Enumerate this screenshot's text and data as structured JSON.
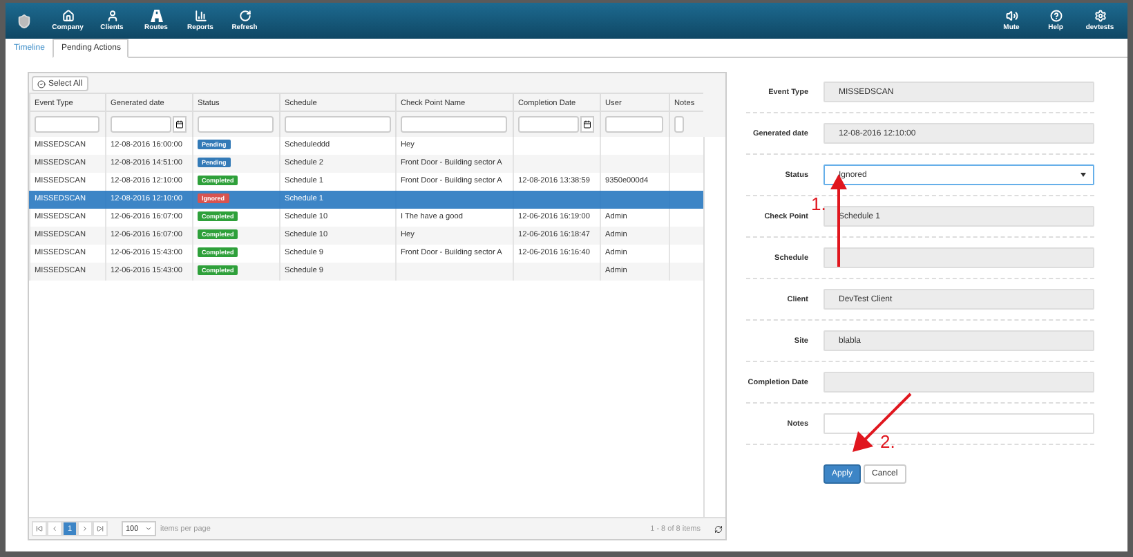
{
  "navbar": {
    "left": [
      {
        "label": "Company"
      },
      {
        "label": "Clients"
      },
      {
        "label": "Routes"
      },
      {
        "label": "Reports"
      },
      {
        "label": "Refresh"
      }
    ],
    "right": [
      {
        "label": "Mute"
      },
      {
        "label": "Help"
      },
      {
        "label": "devtests"
      }
    ]
  },
  "tabs": [
    {
      "label": "Timeline",
      "selected": false
    },
    {
      "label": "Pending Actions",
      "selected": true
    }
  ],
  "grid": {
    "select_all": "Select All",
    "columns": [
      {
        "label": "Event Type",
        "kind": "text"
      },
      {
        "label": "Generated date",
        "kind": "date"
      },
      {
        "label": "Status",
        "kind": "text"
      },
      {
        "label": "Schedule",
        "kind": "text"
      },
      {
        "label": "Check Point Name",
        "kind": "text"
      },
      {
        "label": "Completion Date",
        "kind": "date"
      },
      {
        "label": "User",
        "kind": "text"
      },
      {
        "label": "Notes",
        "kind": "text"
      }
    ],
    "rows": [
      {
        "selected": false,
        "event_type": "MISSEDSCAN",
        "generated": "12-08-2016 16:00:00",
        "status": {
          "text": "Pending",
          "kind": "pending"
        },
        "schedule": "Scheduleddd",
        "check_point": "Hey"
      },
      {
        "selected": false,
        "event_type": "MISSEDSCAN",
        "generated": "12-08-2016 14:51:00",
        "status": {
          "text": "Pending",
          "kind": "pending"
        },
        "schedule": "Schedule 2",
        "check_point": "Front Door - Building sector A"
      },
      {
        "selected": false,
        "event_type": "MISSEDSCAN",
        "generated": "12-08-2016 12:10:00",
        "status": {
          "text": "Completed",
          "kind": "completed"
        },
        "schedule": "Schedule 1",
        "check_point": "Front Door - Building sector A",
        "completion": "12-08-2016 13:38:59",
        "user": "9350e000d4"
      },
      {
        "selected": true,
        "event_type": "MISSEDSCAN",
        "generated": "12-08-2016 12:10:00",
        "status": {
          "text": "Ignored",
          "kind": "ignored"
        },
        "schedule": "Schedule 1"
      },
      {
        "selected": false,
        "event_type": "MISSEDSCAN",
        "generated": "12-06-2016 16:07:00",
        "status": {
          "text": "Completed",
          "kind": "completed"
        },
        "schedule": "Schedule 10",
        "check_point": "I The have a good",
        "completion": "12-06-2016 16:19:00",
        "user": "Admin"
      },
      {
        "selected": false,
        "event_type": "MISSEDSCAN",
        "generated": "12-06-2016 16:07:00",
        "status": {
          "text": "Completed",
          "kind": "completed"
        },
        "schedule": "Schedule 10",
        "check_point": "Hey",
        "completion": "12-06-2016 16:18:47",
        "user": "Admin"
      },
      {
        "selected": false,
        "event_type": "MISSEDSCAN",
        "generated": "12-06-2016 15:43:00",
        "status": {
          "text": "Completed",
          "kind": "completed"
        },
        "schedule": "Schedule 9",
        "check_point": "Front Door - Building sector A",
        "completion": "12-06-2016 16:16:40",
        "user": "Admin"
      },
      {
        "selected": false,
        "event_type": "MISSEDSCAN",
        "generated": "12-06-2016 15:43:00",
        "status": {
          "text": "Completed",
          "kind": "completed"
        },
        "schedule": "Schedule 9",
        "user": "Admin"
      }
    ],
    "pager": {
      "current_page": "1",
      "page_size": "100",
      "page_size_label": "items per page",
      "summary": "1 - 8 of 8 items"
    }
  },
  "form": {
    "fields": [
      {
        "label": "Event Type",
        "value": "MISSEDSCAN",
        "kind": "readonly"
      },
      {
        "label": "Generated date",
        "value": "12-08-2016 12:10:00",
        "kind": "readonly"
      },
      {
        "label": "Status",
        "value": "Ignored",
        "kind": "select"
      },
      {
        "label": "Check Point",
        "value": "Schedule 1",
        "kind": "readonly"
      },
      {
        "label": "Schedule",
        "kind": "readonly"
      },
      {
        "label": "Client",
        "value": "DevTest Client",
        "kind": "readonly"
      },
      {
        "label": "Site",
        "value": "blabla",
        "kind": "readonly"
      },
      {
        "label": "Completion Date",
        "kind": "readonly"
      },
      {
        "label": "Notes",
        "kind": "text"
      }
    ],
    "buttons": [
      {
        "label": "Apply",
        "kind": "primary"
      },
      {
        "label": "Cancel",
        "kind": "default"
      }
    ]
  },
  "annotations": [
    {
      "label": "1.",
      "kind": "up"
    },
    {
      "label": "2.",
      "kind": "down-left"
    }
  ]
}
